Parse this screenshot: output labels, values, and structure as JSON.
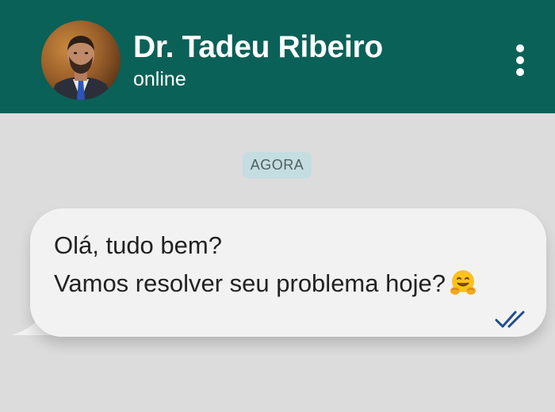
{
  "header": {
    "contact_name": "Dr. Tadeu Ribeiro",
    "status": "online",
    "background_color": "#0a6157"
  },
  "chat": {
    "date_chip": "AGORA",
    "messages": [
      {
        "lines": [
          "Olá, tudo bem?",
          "Vamos resolver seu problema hoje?"
        ],
        "emoji": "hugging-face",
        "status_icon": "double-check-read-icon",
        "check_color": "#1f4c8f"
      }
    ]
  }
}
